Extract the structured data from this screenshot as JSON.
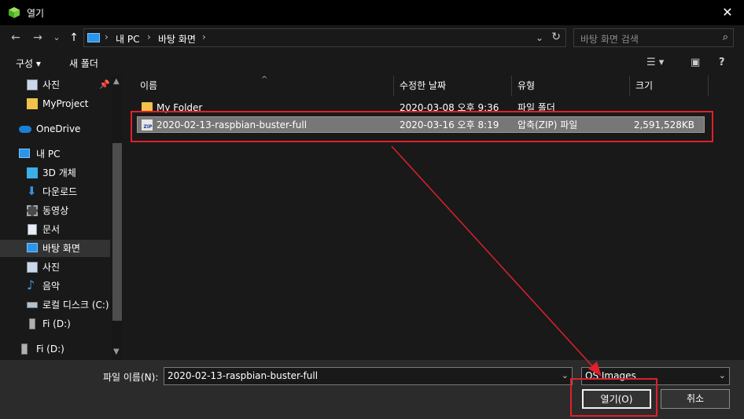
{
  "window": {
    "title": "열기",
    "close_glyph": "✕"
  },
  "nav": {
    "back": "←",
    "forward": "→",
    "recent": "⌄",
    "up": "↑",
    "breadcrumbs": [
      "내 PC",
      "바탕 화면"
    ],
    "separator": "›",
    "search_placeholder": "바탕 화면 검색"
  },
  "toolbar": {
    "organize": "구성 ▾",
    "new_folder": "새 폴더"
  },
  "sidebar": {
    "items": [
      {
        "label": "사진",
        "icon": "pictures-icon",
        "pinned": true
      },
      {
        "label": "MyProject",
        "icon": "folder-icon"
      },
      {
        "label": "OneDrive",
        "icon": "onedrive-icon"
      },
      {
        "label": "내 PC",
        "icon": "pc-icon"
      },
      {
        "label": "3D 개체",
        "icon": "3d-objects-icon"
      },
      {
        "label": "다운로드",
        "icon": "download-icon"
      },
      {
        "label": "동영상",
        "icon": "video-icon"
      },
      {
        "label": "문서",
        "icon": "document-icon"
      },
      {
        "label": "바탕 화면",
        "icon": "desktop-icon",
        "selected": true
      },
      {
        "label": "사진",
        "icon": "pictures-icon"
      },
      {
        "label": "음악",
        "icon": "music-icon"
      },
      {
        "label": "로컬 디스크 (C:)",
        "icon": "drive-icon"
      },
      {
        "label": "Fi (D:)",
        "icon": "usb-drive-icon"
      },
      {
        "label": "Fi (D:)",
        "icon": "usb-drive-icon"
      }
    ]
  },
  "columns": [
    "이름",
    "수정한 날짜",
    "유형",
    "크기"
  ],
  "files": [
    {
      "name": "My Folder",
      "modified": "2020-03-08 오후 9:36",
      "type": "파일 폴더",
      "size": "",
      "icon": "folder-icon"
    },
    {
      "name": "2020-02-13-raspbian-buster-full",
      "modified": "2020-03-16 오후 8:19",
      "type": "압축(ZIP) 파일",
      "size": "2,591,528KB",
      "icon": "zip-icon",
      "selected": true
    }
  ],
  "footer": {
    "filename_label": "파일 이름(N):",
    "filename_value": "2020-02-13-raspbian-buster-full",
    "filter_value": "OS Images",
    "open_button": "열기(O)",
    "cancel_button": "취소"
  },
  "colors": {
    "annotation": "#e0202a",
    "selection": "#777777"
  }
}
